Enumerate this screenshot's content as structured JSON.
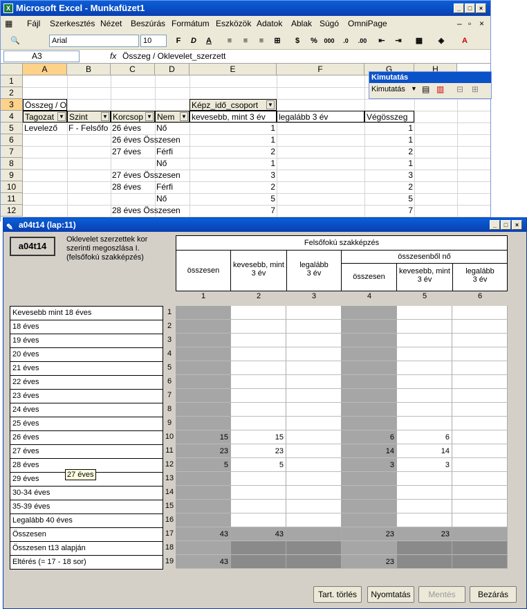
{
  "excel": {
    "title": "Microsoft Excel - Munkafüzet1",
    "menu": [
      "Fájl",
      "Szerkesztés",
      "Nézet",
      "Beszúrás",
      "Formátum",
      "Eszközök",
      "Adatok",
      "Ablak",
      "Súgó",
      "OmniPage"
    ],
    "font": "Arial",
    "size": "10",
    "namebox": "A3",
    "formula": "Összeg / Oklevelet_szerzett",
    "cols": [
      "A",
      "B",
      "C",
      "D",
      "E",
      "F",
      "G",
      "H"
    ],
    "rows": [
      "1",
      "2",
      "3",
      "4",
      "5",
      "6",
      "7",
      "8",
      "9",
      "10",
      "11",
      "12"
    ],
    "cells": {
      "a3": "Összeg / O",
      "e3": "Képz_idő_csoport",
      "a4": "Tagozat",
      "b4": "Szint",
      "c4": "Korcsop",
      "d4": "Nem",
      "e4": "kevesebb, mint 3 év",
      "f4": "legalább 3 év",
      "g4": "Végösszeg",
      "a5": "Levelező",
      "b5": "F - Felsőfo",
      "c5": "26 éves",
      "d5": "Nő",
      "e5": "1",
      "g5": "1",
      "c6": "26 éves Összesen",
      "e6": "1",
      "g6": "1",
      "c7": "27 éves",
      "d7": "Férfi",
      "e7": "2",
      "g7": "2",
      "d8": "Nő",
      "e8": "1",
      "g8": "1",
      "c9": "27 éves Összesen",
      "e9": "3",
      "g9": "3",
      "c10": "28 éves",
      "d10": "Férfi",
      "e10": "2",
      "g10": "2",
      "d11": "Nő",
      "e11": "5",
      "g11": "5",
      "c12": "28 éves Összesen",
      "e12": "7",
      "g12": "7"
    },
    "pivot_toolbar": {
      "title": "Kimutatás",
      "menu": "Kimutatás"
    }
  },
  "form": {
    "title": "a04t14 (lap:11)",
    "code": "a04t14",
    "desc": "Oklevelet szerzettek kor szerinti megoszlása I. (felsőfokú szakképzés)",
    "header_main": "Felsőfokú szakképzés",
    "col_total": "összesen",
    "col_lt3": "kevesebb, mint 3 év",
    "col_ge3": "legalább 3 év",
    "sub_women": "összesenből nő",
    "col_nums": [
      "1",
      "2",
      "3",
      "4",
      "5",
      "6"
    ],
    "rows": [
      {
        "n": "1",
        "label": "Kevesebb mint 18 éves",
        "v": [
          "",
          "",
          "",
          "",
          "",
          ""
        ]
      },
      {
        "n": "2",
        "label": "18 éves",
        "v": [
          "",
          "",
          "",
          "",
          "",
          ""
        ]
      },
      {
        "n": "3",
        "label": "19 éves",
        "v": [
          "",
          "",
          "",
          "",
          "",
          ""
        ]
      },
      {
        "n": "4",
        "label": "20 éves",
        "v": [
          "",
          "",
          "",
          "",
          "",
          ""
        ]
      },
      {
        "n": "5",
        "label": "21 éves",
        "v": [
          "",
          "",
          "",
          "",
          "",
          ""
        ]
      },
      {
        "n": "6",
        "label": "22 éves",
        "v": [
          "",
          "",
          "",
          "",
          "",
          ""
        ]
      },
      {
        "n": "7",
        "label": "23 éves",
        "v": [
          "",
          "",
          "",
          "",
          "",
          ""
        ]
      },
      {
        "n": "8",
        "label": "24 éves",
        "v": [
          "",
          "",
          "",
          "",
          "",
          ""
        ]
      },
      {
        "n": "9",
        "label": "25 éves",
        "v": [
          "",
          "",
          "",
          "",
          "",
          ""
        ]
      },
      {
        "n": "10",
        "label": "26 éves",
        "v": [
          "15",
          "15",
          "",
          "6",
          "6",
          ""
        ]
      },
      {
        "n": "11",
        "label": "27 éves",
        "v": [
          "23",
          "23",
          "",
          "14",
          "14",
          ""
        ]
      },
      {
        "n": "12",
        "label": "28 éves",
        "v": [
          "5",
          "5",
          "",
          "3",
          "3",
          ""
        ]
      },
      {
        "n": "13",
        "label": "29 éves",
        "v": [
          "",
          "",
          "",
          "",
          "",
          ""
        ]
      },
      {
        "n": "14",
        "label": "30-34 éves",
        "v": [
          "",
          "",
          "",
          "",
          "",
          ""
        ]
      },
      {
        "n": "15",
        "label": "35-39 éves",
        "v": [
          "",
          "",
          "",
          "",
          "",
          ""
        ]
      },
      {
        "n": "16",
        "label": "Legalább 40 éves",
        "v": [
          "",
          "",
          "",
          "",
          "",
          ""
        ]
      },
      {
        "n": "17",
        "label": "Összesen",
        "v": [
          "43",
          "43",
          "",
          "23",
          "23",
          ""
        ]
      },
      {
        "n": "18",
        "label": "Összesen t13 alapján",
        "v": [
          "",
          "",
          "",
          "",
          "",
          ""
        ]
      },
      {
        "n": "19",
        "label": "Eltérés (= 17 - 18 sor)",
        "v": [
          "43",
          "",
          "",
          "23",
          "",
          ""
        ]
      }
    ],
    "tooltip": "27 éves",
    "buttons": {
      "clear": "Tart. törlés",
      "print": "Nyomtatás",
      "save": "Mentés",
      "close": "Bezárás"
    }
  }
}
